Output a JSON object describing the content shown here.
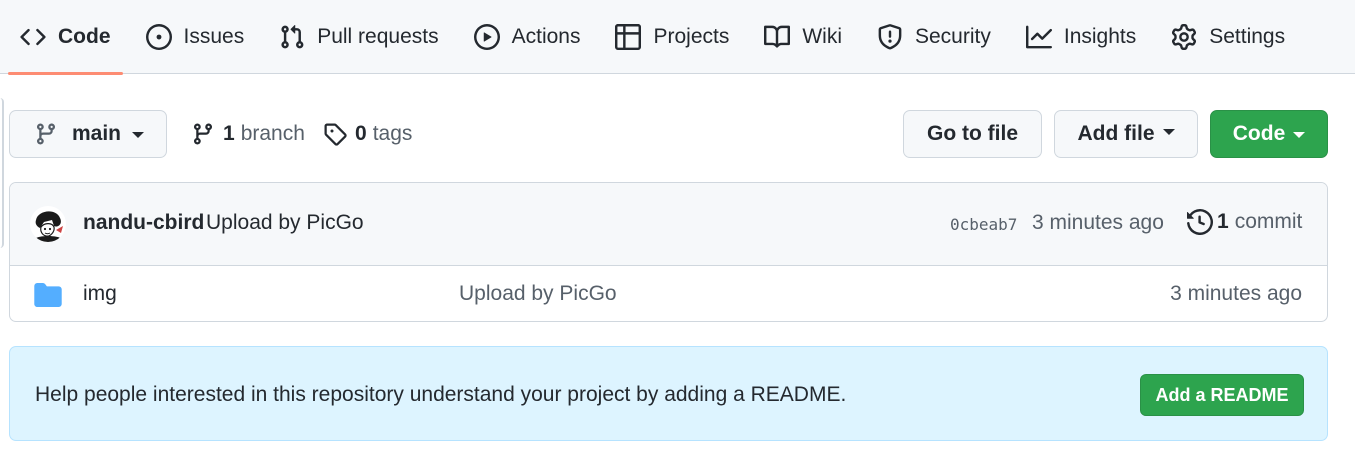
{
  "nav": {
    "items": [
      {
        "label": "Code",
        "icon": "code-icon",
        "active": true
      },
      {
        "label": "Issues",
        "icon": "issue-opened-icon"
      },
      {
        "label": "Pull requests",
        "icon": "git-pull-request-icon"
      },
      {
        "label": "Actions",
        "icon": "play-icon"
      },
      {
        "label": "Projects",
        "icon": "table-icon"
      },
      {
        "label": "Wiki",
        "icon": "book-icon"
      },
      {
        "label": "Security",
        "icon": "shield-icon"
      },
      {
        "label": "Insights",
        "icon": "graph-icon"
      },
      {
        "label": "Settings",
        "icon": "gear-icon"
      }
    ],
    "active_underline_color": "#fd8c73"
  },
  "toolbar": {
    "branch_name": "main",
    "branch_count": "1",
    "branch_label": "branch",
    "tag_count": "0",
    "tag_label": "tags",
    "go_to_file_label": "Go to file",
    "add_file_label": "Add file",
    "code_label": "Code"
  },
  "latest_commit": {
    "author": "nandu-cbird",
    "message": "Upload by PicGo",
    "sha": "0cbeab7",
    "time": "3 minutes ago",
    "commit_count": "1",
    "commit_label": "commit"
  },
  "files": [
    {
      "name": "img",
      "type": "folder",
      "message": "Upload by PicGo",
      "time": "3 minutes ago",
      "icon": "folder-icon"
    }
  ],
  "readme_banner": {
    "text": "Help people interested in this repository understand your project by adding a README.",
    "button_label": "Add a README"
  },
  "colors": {
    "primary_green": "#2da44e",
    "folder_blue": "#54aeff",
    "banner_bg": "#ddf4ff"
  }
}
